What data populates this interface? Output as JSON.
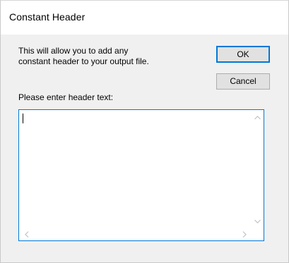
{
  "window": {
    "title": "Constant Header"
  },
  "content": {
    "description": "This will allow you to add any\nconstant header to your output file.",
    "prompt": "Please enter header text:"
  },
  "buttons": {
    "ok_label": "OK",
    "cancel_label": "Cancel"
  },
  "header_text": {
    "value": ""
  },
  "colors": {
    "accent": "#0078d7",
    "client_bg": "#f0f0f0",
    "button_bg": "#e1e1e1",
    "scroll_arrow": "#c2c2c2"
  },
  "icons": {
    "scroll_up": "chevron-up-icon",
    "scroll_down": "chevron-down-icon",
    "scroll_left": "chevron-left-icon",
    "scroll_right": "chevron-right-icon"
  }
}
